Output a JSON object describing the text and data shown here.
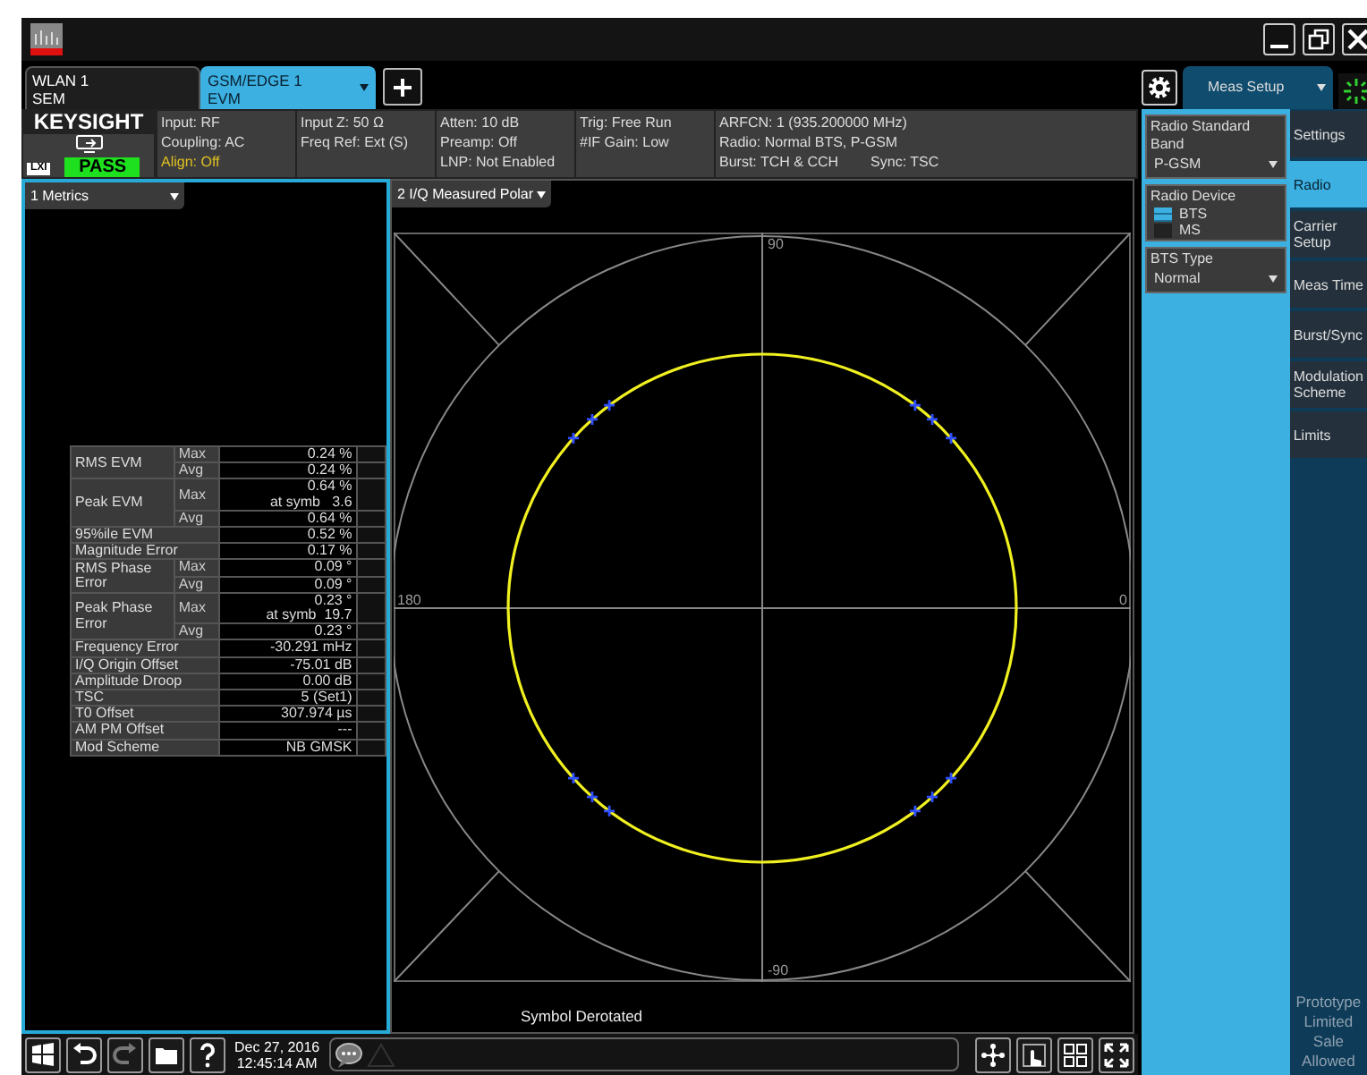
{
  "tabs": [
    {
      "line1": "WLAN 1",
      "line2": "SEM",
      "selected": false
    },
    {
      "line1": "GSM/EDGE 1",
      "line2": "EVM",
      "selected": true
    }
  ],
  "status": {
    "brand": "KEYSIGHT",
    "lxi": "LXI",
    "verdict": "PASS",
    "columns": [
      [
        {
          "parts": [
            "Input: RF"
          ],
          "alert": false
        },
        {
          "parts": [
            "Coupling: AC"
          ],
          "alert": false
        },
        {
          "parts": [
            "Align: Off"
          ],
          "alert": true
        }
      ],
      [
        {
          "parts": [
            "Input Z: 50 Ω"
          ],
          "alert": false
        },
        {
          "parts": [
            "Freq Ref: Ext (S)"
          ],
          "alert": false
        }
      ],
      [
        {
          "parts": [
            "Atten: 10 dB"
          ],
          "alert": false
        },
        {
          "parts": [
            "Preamp: Off"
          ],
          "alert": false
        },
        {
          "parts": [
            "LNP: Not Enabled"
          ],
          "alert": false
        }
      ],
      [
        {
          "parts": [
            "Trig: Free Run"
          ],
          "alert": false
        },
        {
          "parts": [
            "#IF Gain: Low"
          ],
          "alert": false
        }
      ],
      [
        {
          "parts": [
            "ARFCN: 1  (935.200000 MHz)"
          ],
          "alert": false
        },
        {
          "parts": [
            "Radio: Normal BTS, P-GSM"
          ],
          "alert": false
        },
        {
          "parts": [
            "Burst: TCH & CCH",
            "Sync: TSC"
          ],
          "alert": false
        }
      ]
    ]
  },
  "panes": [
    {
      "title": "1 Metrics",
      "active": true
    },
    {
      "title": "2 I/Q Measured Polar",
      "active": false
    }
  ],
  "metrics": [
    {
      "label": "RMS EVM",
      "rows": [
        {
          "stat": "Max",
          "value": "0.24 %"
        },
        {
          "stat": "Avg",
          "value": "0.24 %"
        }
      ]
    },
    {
      "label": "Peak EVM",
      "rows": [
        {
          "stat": "Max",
          "value": "0.64 %",
          "note": "at symb   3.6"
        },
        {
          "stat": "Avg",
          "value": "0.64 %"
        }
      ]
    },
    {
      "label": "95%ile EVM",
      "rows": [
        {
          "value": "0.52 %"
        }
      ]
    },
    {
      "label": "Magnitude Error",
      "rows": [
        {
          "value": "0.17 %"
        }
      ]
    },
    {
      "label": "RMS Phase Error",
      "rows": [
        {
          "stat": "Max",
          "value": "0.09 °"
        },
        {
          "stat": "Avg",
          "value": "0.09 °"
        }
      ]
    },
    {
      "label": "Peak Phase Error",
      "rows": [
        {
          "stat": "Max",
          "value": "0.23 °",
          "note": "at symb  19.7"
        },
        {
          "stat": "Avg",
          "value": "0.23 °"
        }
      ]
    },
    {
      "label": "Frequency Error",
      "rows": [
        {
          "value": "-30.291 mHz"
        }
      ]
    },
    {
      "label": "I/Q Origin Offset",
      "rows": [
        {
          "value": "-75.01 dB"
        }
      ]
    },
    {
      "label": "Amplitude Droop",
      "rows": [
        {
          "value": "0.00 dB"
        }
      ]
    },
    {
      "label": "TSC",
      "rows": [
        {
          "value": "5 (Set1)"
        }
      ]
    },
    {
      "label": "T0 Offset",
      "rows": [
        {
          "value": "307.974 µs"
        }
      ]
    },
    {
      "label": "AM PM Offset",
      "rows": [
        {
          "value": "---"
        }
      ]
    },
    {
      "label": "Mod Scheme",
      "rows": [
        {
          "value": "NB GMSK"
        }
      ]
    }
  ],
  "polar": {
    "axis_labels": [
      "90",
      "180",
      "0",
      "-90"
    ],
    "caption": "Symbol Derotated"
  },
  "meas_tab": "Meas Setup",
  "side_panel": {
    "band": {
      "label": "Radio Standard Band",
      "value": "P-GSM"
    },
    "device": {
      "label": "Radio Device",
      "options": [
        {
          "label": "BTS",
          "selected": true
        },
        {
          "label": "MS",
          "selected": false
        }
      ]
    },
    "bts_type": {
      "label": "BTS Type",
      "value": "Normal"
    }
  },
  "softkeys": [
    {
      "label": "Settings",
      "selected": false
    },
    {
      "label": "Radio",
      "selected": true
    },
    {
      "label": "Carrier Setup",
      "selected": false
    },
    {
      "label": "Meas Time",
      "selected": false
    },
    {
      "label": "Burst/Sync",
      "selected": false
    },
    {
      "label": "Modulation Scheme",
      "selected": false
    },
    {
      "label": "Limits",
      "selected": false
    }
  ],
  "notice": "Prototype Limited Sale Allowed",
  "taskbar": {
    "buttons": [
      {
        "kind": "windows",
        "disabled": false
      },
      {
        "kind": "undo",
        "disabled": false
      },
      {
        "kind": "redo",
        "disabled": true
      },
      {
        "kind": "folder",
        "disabled": false
      },
      {
        "kind": "help",
        "disabled": false
      }
    ],
    "date": "Dec 27, 2016",
    "time": "12:45:14 AM"
  }
}
